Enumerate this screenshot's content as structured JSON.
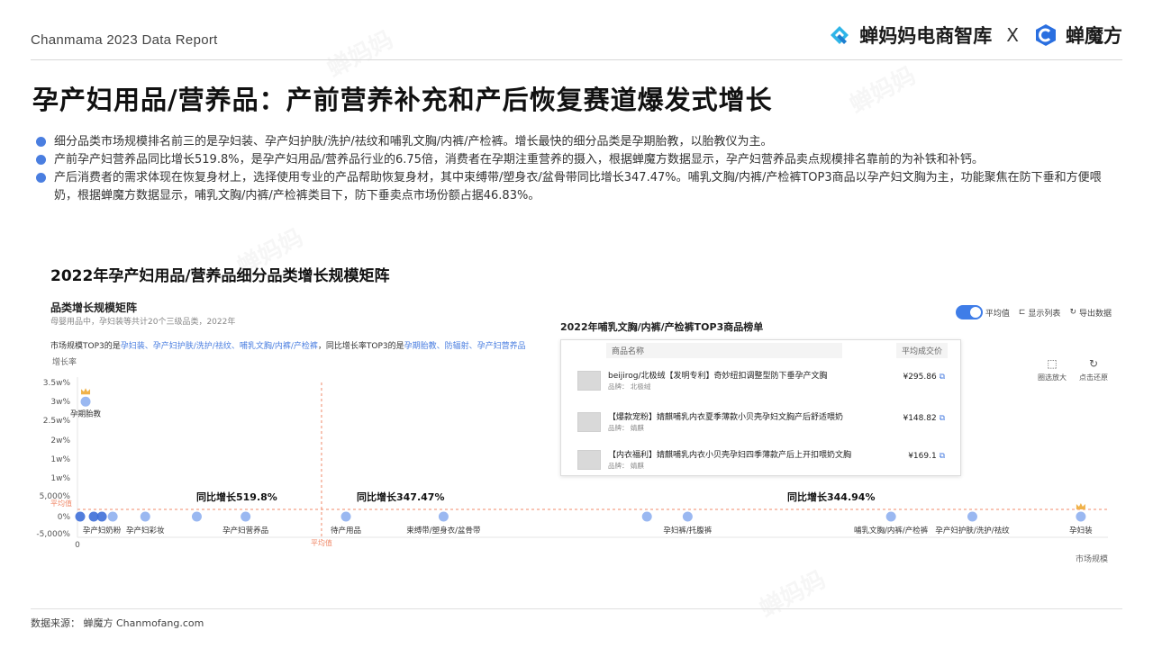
{
  "header": {
    "report": "Chanmama 2023 Data Report",
    "brand1": "蝉妈妈电商智库",
    "separator": "X",
    "brand2": "蝉魔方"
  },
  "title": "孕产妇用品/营养品：产前营养补充和产后恢复赛道爆发式增长",
  "bullets": [
    "细分品类市场规模排名前三的是孕妇装、孕产妇护肤/洗护/祛纹和哺乳文胸/内裤/产检裤。增长最快的细分品类是孕期胎教，以胎教仪为主。",
    "产前孕产妇营养品同比增长519.8%，是孕产妇用品/营养品行业的6.75倍，消费者在孕期注重营养的摄入，根据蝉魔方数据显示，孕产妇营养品卖点规模排名靠前的为补铁和补钙。",
    "产后消费者的需求体现在恢复身材上，选择使用专业的产品帮助恢复身材，其中束缚带/塑身衣/盆骨带同比增长347.47%。哺乳文胸/内裤/产检裤TOP3商品以孕产妇文胸为主，功能聚焦在防下垂和方便喂奶，根据蝉魔方数据显示，哺乳文胸/内裤/产检裤类目下，防下垂卖点市场份额占据46.83%。"
  ],
  "chart_title": "2022年孕产妇用品/营养品细分品类增长规模矩阵",
  "panel": {
    "heading": "品类增长规模矩阵",
    "subheading": "母婴用品中，孕妇装等共计20个三级品类，2022年",
    "summary_prefix": "市场规模TOP3的是",
    "summary_top3": "孕妇装、孕产妇护肤/洗护/祛纹、哺乳文胸/内裤/产检裤",
    "summary_mid": "，同比增长率TOP3的是",
    "summary_growth": "孕期胎教、防辐射、孕产妇营养品",
    "toggle_label": "平均值",
    "show_list": "显示列表",
    "export": "导出数据",
    "zoom": "圈选放大",
    "reset": "点击还原"
  },
  "top3": {
    "title": "2022年哺乳文胸/内裤/产检裤TOP3商品榜单",
    "col_name": "商品名称",
    "col_price": "平均成交价",
    "items": [
      {
        "name": "beijirog/北极绒【发明专利】奇妙纽扣调整型防下垂孕产文胸",
        "brand": "品牌：  北极绒",
        "price": "¥295.86"
      },
      {
        "name": "【爆款宠粉】婧麒哺乳内衣夏季薄款小贝壳孕妇文胸产后舒适喂奶",
        "brand": "品牌：  婧麒",
        "price": "¥148.82"
      },
      {
        "name": "【内衣福利】婧麒哺乳内衣小贝壳孕妇四季薄款产后上开扣喂奶文胸",
        "brand": "品牌：  婧麒",
        "price": "¥169.1"
      }
    ]
  },
  "annotations": {
    "a1": "同比增长519.8%",
    "a2": "同比增长347.47%",
    "a3": "同比增长344.94%"
  },
  "colors": {
    "accent": "#4a7ee0",
    "point": "#8fb0f0",
    "point_dark": "#3e6fd8",
    "avg_line": "#f08a6a",
    "crown": "#f0b24a"
  },
  "chart_data": {
    "type": "scatter",
    "title": "品类增长规模矩阵",
    "ylabel": "增长率",
    "xlabel": "市场规模",
    "y_ticks": [
      "3.5w%",
      "3w%",
      "2.5w%",
      "2w%",
      "1w%",
      "1w%",
      "5,000%",
      "0%",
      "-5,000%"
    ],
    "x_zero_label": "0",
    "avg_label": "平均值",
    "category_labels": [
      "孕期胎教",
      "孕产妇奶粉",
      "孕产妇彩妆",
      "孕产妇营养品",
      "待产用品",
      "束缚带/塑身衣/盆骨带",
      "孕妇裤/托腹裤",
      "哺乳文胸/内裤/产检裤",
      "孕产妇护肤/洗护/祛纹",
      "孕妇装"
    ],
    "points": [
      {
        "label": "孕期胎教",
        "x": 0.3,
        "y": 30000
      },
      {
        "label": "",
        "x": 0.1,
        "y": 0
      },
      {
        "label": "",
        "x": 0.6,
        "y": 0
      },
      {
        "label": "孕产妇奶粉",
        "x": 0.9,
        "y": 0
      },
      {
        "label": "",
        "x": 1.3,
        "y": 0
      },
      {
        "label": "孕产妇彩妆",
        "x": 2.5,
        "y": 0
      },
      {
        "label": "",
        "x": 4.4,
        "y": 0
      },
      {
        "label": "孕产妇营养品",
        "x": 6.2,
        "y": 519.8
      },
      {
        "label": "待产用品",
        "x": 9.9,
        "y": 0
      },
      {
        "label": "束缚带/塑身衣/盆骨带",
        "x": 13.5,
        "y": 347.47
      },
      {
        "label": "",
        "x": 21.0,
        "y": 0
      },
      {
        "label": "孕妇裤/托腹裤",
        "x": 22.5,
        "y": 0
      },
      {
        "label": "哺乳文胸/内裤/产检裤",
        "x": 30.0,
        "y": 344.94
      },
      {
        "label": "孕产妇护肤/洗护/祛纹",
        "x": 33.0,
        "y": 0
      },
      {
        "label": "孕妇装",
        "x": 37.0,
        "y": 0
      }
    ],
    "average": {
      "x": 9.0,
      "y": 0
    }
  },
  "footer": "数据来源：  蝉魔方  Chanmofang.com"
}
